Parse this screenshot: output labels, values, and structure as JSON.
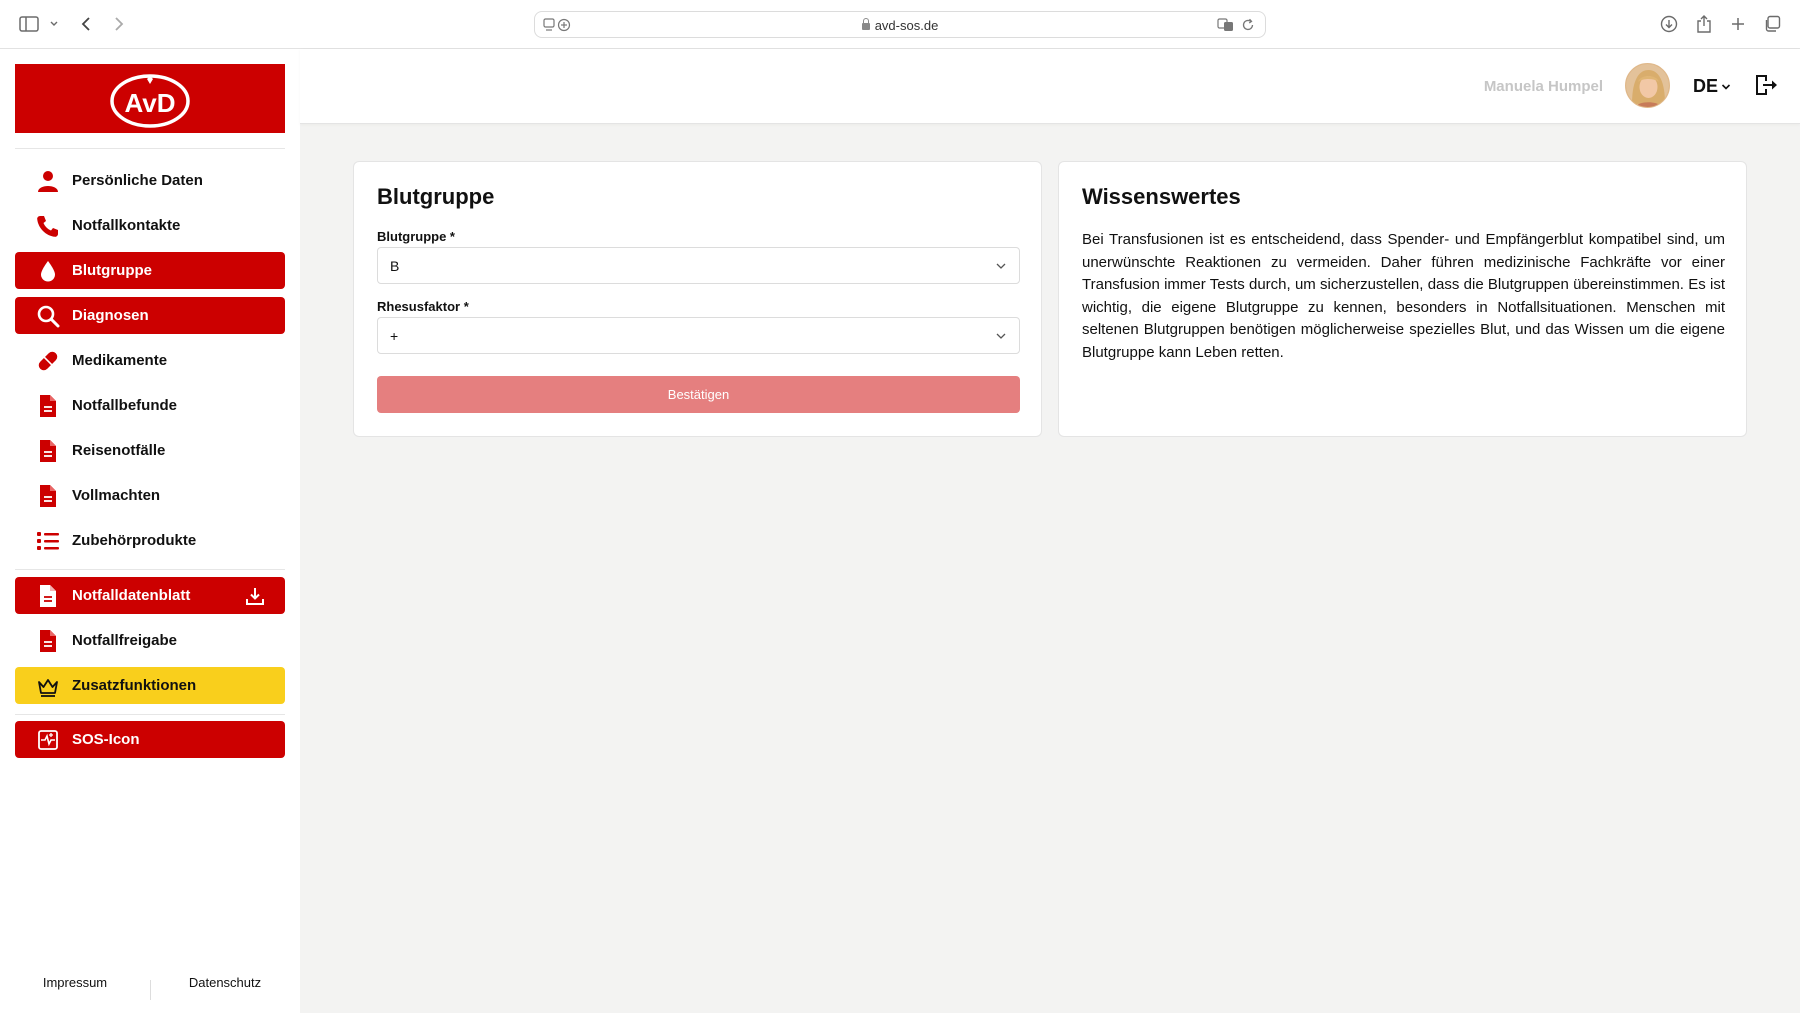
{
  "browser": {
    "url": "avd-sos.de"
  },
  "brand": {
    "logo_text": "AvD",
    "primary_color": "#cc0000",
    "accent_color": "#f9cf1c",
    "button_disabled_color": "#e57f7f"
  },
  "sidebar": {
    "items": [
      {
        "label": "Persönliche Daten",
        "icon": "person-icon",
        "style": "plain"
      },
      {
        "label": "Notfallkontakte",
        "icon": "phone-icon",
        "style": "plain"
      },
      {
        "label": "Blutgruppe",
        "icon": "blood-drop-icon",
        "style": "red"
      },
      {
        "label": "Diagnosen",
        "icon": "magnifier-icon",
        "style": "red"
      },
      {
        "label": "Medikamente",
        "icon": "pill-icon",
        "style": "plain"
      },
      {
        "label": "Notfallbefunde",
        "icon": "document-icon",
        "style": "plain"
      },
      {
        "label": "Reisenotfälle",
        "icon": "document-icon",
        "style": "plain"
      },
      {
        "label": "Vollmachten",
        "icon": "document-icon",
        "style": "plain"
      },
      {
        "label": "Zubehörprodukte",
        "icon": "list-icon",
        "style": "plain"
      },
      {
        "label": "Notfalldatenblatt",
        "icon": "document-icon",
        "style": "red",
        "trailing_icon": "download-icon"
      },
      {
        "label": "Notfallfreigabe",
        "icon": "document-icon",
        "style": "plain"
      },
      {
        "label": "Zusatzfunktionen",
        "icon": "crown-icon",
        "style": "yellow"
      },
      {
        "label": "SOS-Icon",
        "icon": "heartbeat-icon",
        "style": "red"
      }
    ],
    "footer": {
      "impressum": "Impressum",
      "datenschutz": "Datenschutz"
    }
  },
  "header": {
    "user_name": "Manuela Humpel",
    "language": "DE"
  },
  "blood_card": {
    "title": "Blutgruppe",
    "blood_group_label": "Blutgruppe *",
    "blood_group_value": "B",
    "rhesus_label": "Rhesusfaktor *",
    "rhesus_value": "+",
    "confirm_label": "Bestätigen"
  },
  "info_card": {
    "title": "Wissenswertes",
    "text": "Bei Transfusionen ist es entscheidend, dass Spender- und Empfängerblut kompatibel sind, um unerwünschte Reaktionen zu vermeiden. Daher führen medizinische Fachkräfte vor einer Transfusion immer Tests durch, um sicherzustellen, dass die Blutgruppen übereinstimmen. Es ist wichtig, die eigene Blutgruppe zu kennen, besonders in Notfallsituationen. Menschen mit seltenen Blutgruppen benötigen möglicherweise spezielles Blut, und das Wissen um die eigene Blutgruppe kann Leben retten."
  }
}
